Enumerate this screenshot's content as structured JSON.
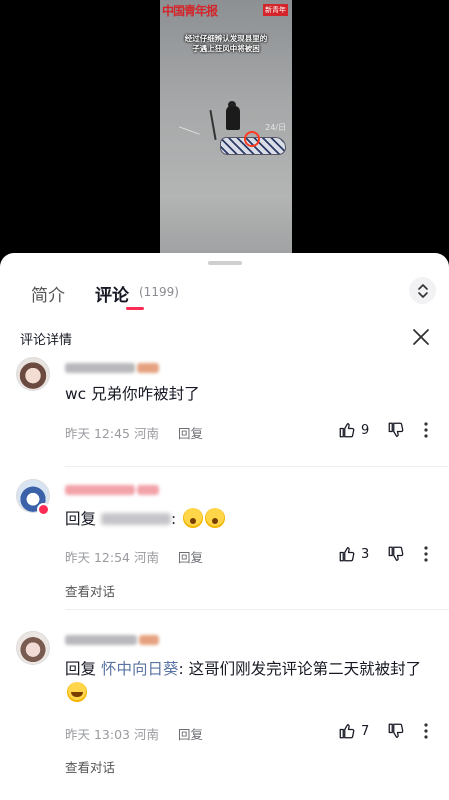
{
  "video": {
    "logo_text": "中国青年报",
    "badge_text": "新青年",
    "caption_line1": "经过仔细辨认发现县里的",
    "caption_line2": "子遇上狂风中将被困",
    "watermark": "24/日"
  },
  "tabs": {
    "intro_label": "简介",
    "comments_label": "评论",
    "comments_count": "(1199)"
  },
  "detail": {
    "title": "评论详情"
  },
  "comments": [
    {
      "text": "wc 兄弟你咋被封了",
      "time": "昨天 12:45",
      "location": "河南",
      "reply_label": "回复",
      "likes": "9"
    },
    {
      "reply_prefix": "回复",
      "reply_suffix": ":",
      "time": "昨天 12:54",
      "location": "河南",
      "reply_label": "回复",
      "likes": "3",
      "view_thread": "查看对话"
    },
    {
      "reply_prefix": "回复",
      "reply_target": "怀中向日葵",
      "text": ": 这哥们刚发完评论第二天就被封了",
      "time": "昨天 13:03",
      "location": "河南",
      "reply_label": "回复",
      "likes": "7",
      "view_thread": "查看对话"
    }
  ],
  "icons": {
    "expand": "chevron-up-down-icon",
    "close": "close-icon",
    "like": "thumb-up-icon",
    "dislike": "thumb-down-icon",
    "more": "more-vertical-icon"
  },
  "colors": {
    "accent": "#fe2c55",
    "reply_target": "#5a74a3",
    "muted_text": "#9a9ba0"
  }
}
